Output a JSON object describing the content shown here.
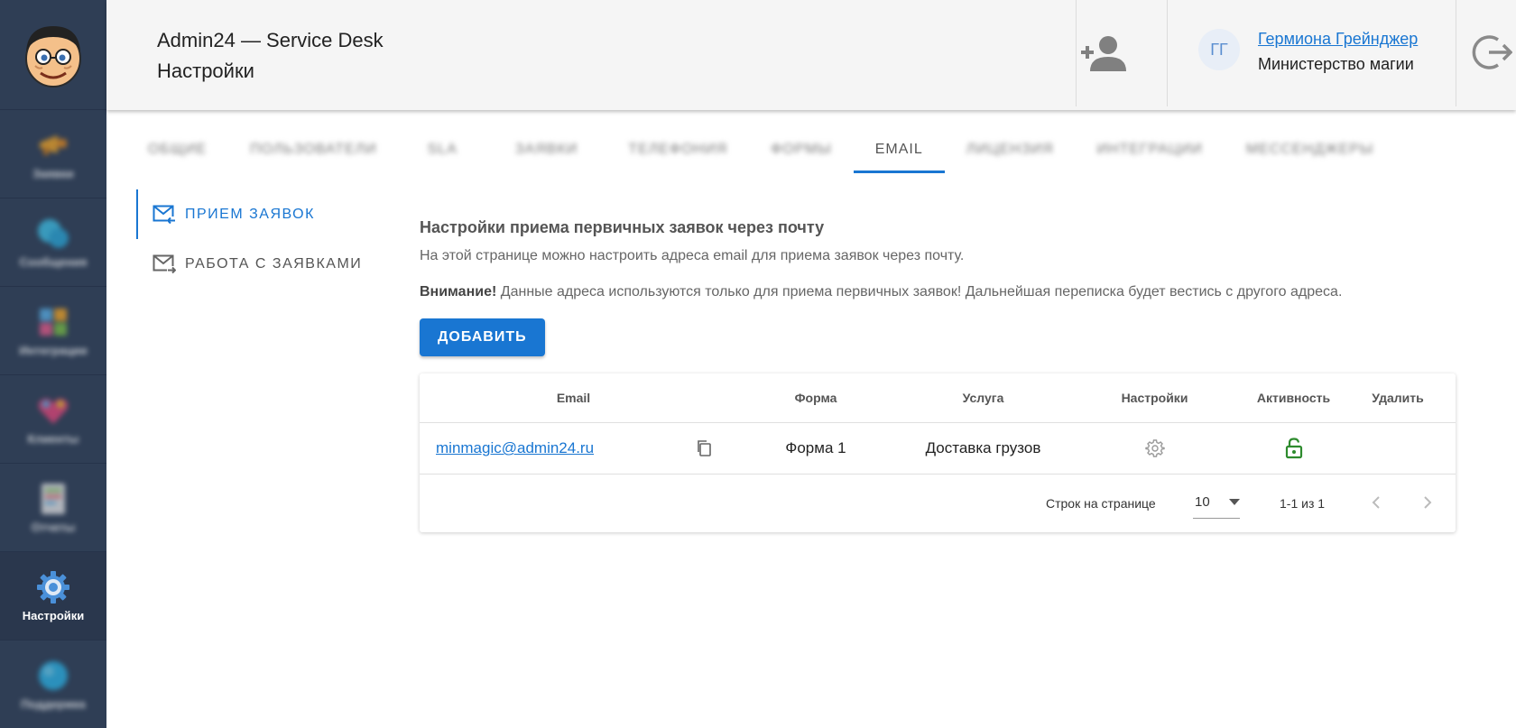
{
  "header": {
    "title_line1": "Admin24 — Service Desk",
    "title_line2": "Настройки",
    "user": {
      "initials": "ГГ",
      "name": "Гермиона Грейнджер",
      "organization": "Министерство магии"
    }
  },
  "sidebar": {
    "items": [
      {
        "label": "Заявки",
        "icon": "megaphone-icon",
        "blurred": true
      },
      {
        "label": "Сообщения",
        "icon": "chat-bubbles-icon",
        "blurred": true
      },
      {
        "label": "Интеграции",
        "icon": "puzzle-icon",
        "blurred": true
      },
      {
        "label": "Клиенты",
        "icon": "heart-icon",
        "blurred": true
      },
      {
        "label": "Отчеты",
        "icon": "report-icon",
        "blurred": true
      },
      {
        "label": "Настройки",
        "icon": "gear-icon",
        "blurred": false,
        "active": true
      },
      {
        "label": "Поддержка",
        "icon": "globe-icon",
        "blurred": true
      }
    ]
  },
  "tabs": [
    {
      "label": "Общие",
      "blurred": true
    },
    {
      "label": "Пользователи",
      "blurred": true
    },
    {
      "label": "SLA",
      "blurred": true
    },
    {
      "label": "Заявки",
      "blurred": true
    },
    {
      "label": "Телефония",
      "blurred": true
    },
    {
      "label": "Формы",
      "blurred": true
    },
    {
      "label": "EMAIL",
      "blurred": false,
      "active": true
    },
    {
      "label": "Лицензия",
      "blurred": true
    },
    {
      "label": "Интеграции",
      "blurred": true
    },
    {
      "label": "Мессенджеры",
      "blurred": true
    }
  ],
  "subnav": {
    "items": [
      {
        "label": "ПРИЕМ ЗАЯВОК",
        "active": true
      },
      {
        "label": "РАБОТА С ЗАЯВКАМИ",
        "active": false
      }
    ]
  },
  "content": {
    "title": "Настройки приема первичных заявок через почту",
    "description": "На этой странице можно настроить адреса email для приема заявок через почту.",
    "warning_bold": "Внимание!",
    "warning_text": " Данные адреса используются только для приема первичных заявок! Дальнейшая переписка будет вестись с другого адреса.",
    "add_button": "ДОБАВИТЬ"
  },
  "table": {
    "columns": [
      "Email",
      "Форма",
      "Услуга",
      "Настройки",
      "Активность",
      "Удалить"
    ],
    "rows": [
      {
        "email": "minmagic@admin24.ru",
        "form": "Форма 1",
        "service": "Доставка грузов",
        "active": true
      }
    ],
    "footer": {
      "rows_per_page_label": "Строк на странице",
      "rows_per_page_value": "10",
      "range": "1-1 из 1"
    }
  },
  "colors": {
    "sidebar_bg": "#2f3e55",
    "accent": "#1976d2",
    "active_status": "#2e8b2e"
  }
}
